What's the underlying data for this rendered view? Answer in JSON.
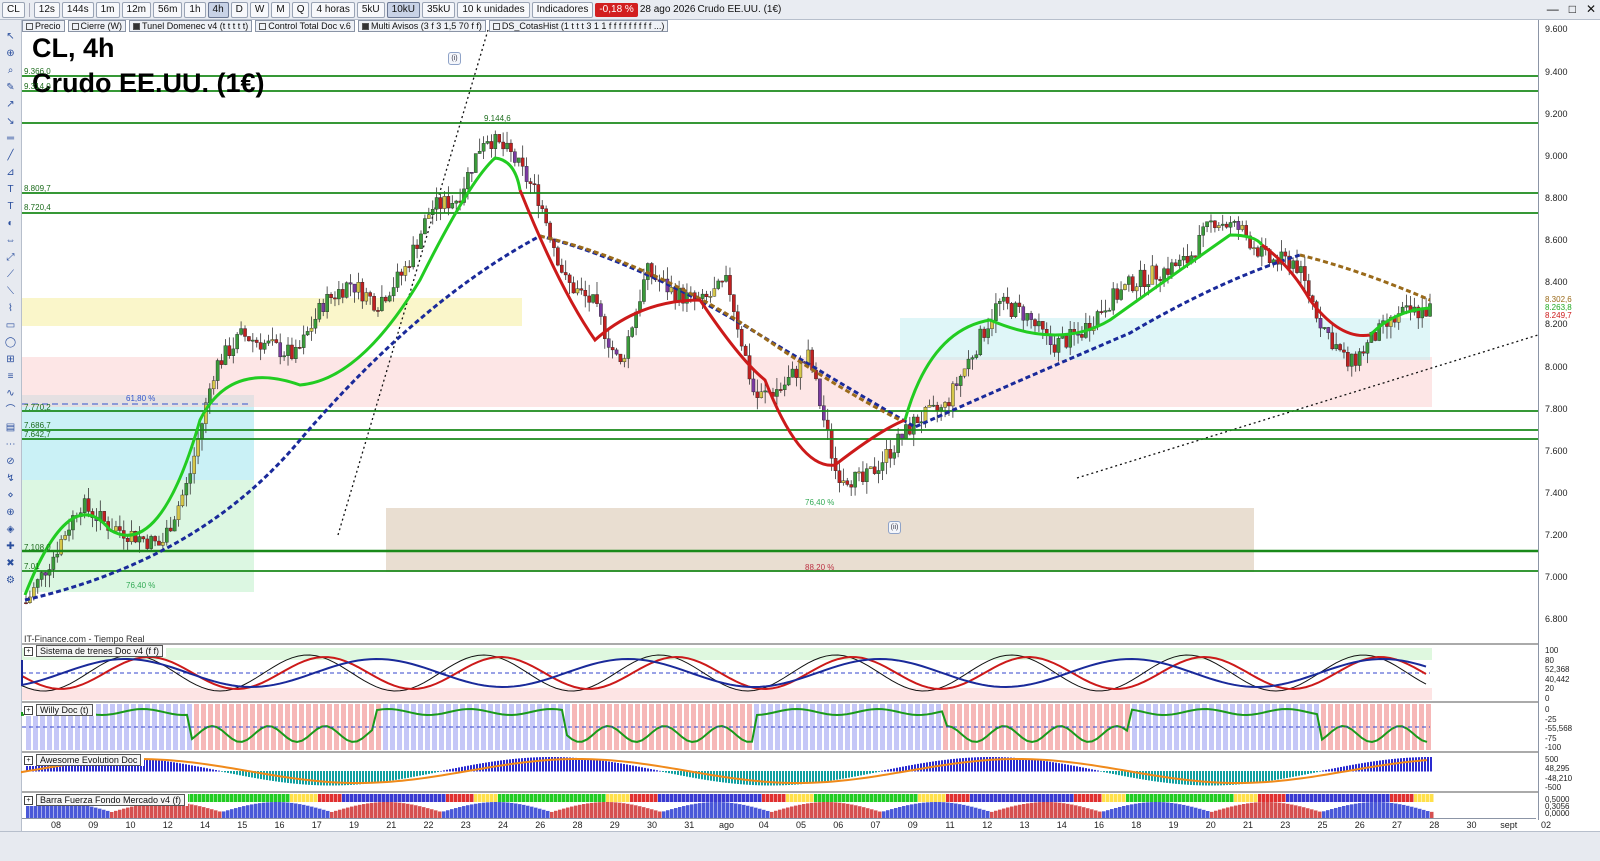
{
  "toolbar": {
    "symbol": "CL",
    "timeframes": [
      "12s",
      "144s",
      "1m",
      "12m",
      "56m",
      "1h",
      "4h",
      "D",
      "W",
      "M",
      "Q"
    ],
    "active_timeframe": "4h",
    "interval_select": "4 horas",
    "ticks": [
      "5kU",
      "10kU",
      "35kU"
    ],
    "active_tick": "10kU",
    "units_select": "10 k unidades",
    "indicators_label": "Indicadores",
    "change_pct": "-0,18 %",
    "date": "28 ago 2026",
    "instrument": "Crudo EE.UU. (1€)"
  },
  "tabs": [
    {
      "label": "Precio",
      "checked": false
    },
    {
      "label": "Cierre (W)",
      "checked": false
    },
    {
      "label": "Tunel Domenec v4 (t t t t t)",
      "checked": true
    },
    {
      "label": "Control Total Doc v.6",
      "checked": false
    },
    {
      "label": "Multi Avisos (3 f 3 1,5 70 f f)",
      "checked": true
    },
    {
      "label": "DS_CotasHist (1 t t t 3 1 1 f f f f f f f f f ...)",
      "checked": false
    }
  ],
  "chart": {
    "title": "CL, 4h",
    "subtitle": "Crudo EE.UU. (1€)",
    "source": "IT-Finance.com - Tiempo Real",
    "price_labels": [
      "9.600",
      "9.400",
      "9.200",
      "9.000",
      "8.800",
      "8.600",
      "8.400",
      "8.200",
      "8.000",
      "7.800",
      "7.600",
      "7.400",
      "7.200",
      "7.000",
      "6.800"
    ],
    "price_tags": [
      "8.302,6",
      "8.263,8",
      "8.249,7"
    ],
    "level_labels": [
      "9.366,0",
      "9.314,0",
      "8.809,7",
      "8.720,4",
      "7.770,2",
      "7.686,7",
      "7.642,7",
      "7.108,0",
      "7.01"
    ],
    "peak_label": "9.144,6",
    "fib_labels": {
      "fib_6180": "61,80 %",
      "fib_7640_a": "76,40 %",
      "fib_7640_b": "76,40 %",
      "fib_8820": "88,20 %"
    },
    "wave_labels": [
      "(i)",
      "(ii)"
    ]
  },
  "chart_data": {
    "type": "candlestick",
    "title": "CL, 4h",
    "subtitle": "Crudo EE.UU. (1€)",
    "ylim": [
      6.7,
      9.65
    ],
    "x_dates": [
      "08",
      "09",
      "10",
      "12",
      "14",
      "15",
      "16",
      "17",
      "19",
      "21",
      "22",
      "23",
      "24",
      "26",
      "28",
      "29",
      "30",
      "31",
      "ago",
      "04",
      "05",
      "06",
      "07",
      "09",
      "11",
      "12",
      "13",
      "14",
      "16",
      "18",
      "19",
      "20",
      "21",
      "23",
      "25",
      "26",
      "27",
      "28",
      "30",
      "sept",
      "02"
    ],
    "close_path": [
      6.88,
      7.1,
      7.35,
      7.25,
      7.2,
      7.15,
      7.45,
      8.0,
      8.15,
      8.1,
      8.05,
      8.3,
      8.4,
      8.3,
      8.45,
      8.75,
      8.8,
      9.1,
      9.0,
      8.8,
      8.4,
      8.3,
      8.0,
      8.45,
      8.35,
      8.3,
      8.4,
      7.85,
      7.9,
      8.05,
      7.5,
      7.45,
      7.6,
      7.75,
      7.8,
      8.05,
      8.3,
      8.25,
      8.1,
      8.15,
      8.3,
      8.4,
      8.45,
      8.5,
      8.7,
      8.65,
      8.5,
      8.5,
      8.2,
      8.0,
      8.15,
      8.25,
      8.27
    ]
  },
  "panels": [
    {
      "name": "Sistema de trenes Doc v4 (f f)",
      "axis": [
        "100",
        "80",
        "52,368",
        "40,442",
        "20",
        "0"
      ]
    },
    {
      "name": "Willy Doc (t)",
      "axis": [
        "0",
        "-25",
        "-55,568",
        "-75",
        "-100"
      ]
    },
    {
      "name": "Awesome Evolution Doc",
      "axis": [
        "500",
        "48,295",
        "-48,210",
        "-500"
      ]
    },
    {
      "name": "Barra Fuerza Fondo Mercado v4 (f)",
      "axis": [
        "0,5000",
        "0,3056",
        "0,0000"
      ]
    }
  ],
  "date_axis": [
    "08",
    "09",
    "10",
    "12",
    "14",
    "15",
    "16",
    "17",
    "19",
    "21",
    "22",
    "23",
    "24",
    "26",
    "28",
    "29",
    "30",
    "31",
    "ago",
    "04",
    "05",
    "06",
    "07",
    "09",
    "11",
    "12",
    "13",
    "14",
    "16",
    "18",
    "19",
    "20",
    "21",
    "23",
    "25",
    "26",
    "27",
    "28",
    "30",
    "sept",
    "02"
  ],
  "colors": {
    "green_level": "#1a8a1a",
    "up": "#3a9a3a",
    "down": "#c02020",
    "ma_blue": "#1a2a9a",
    "ma_brown": "#9a6a1a"
  }
}
